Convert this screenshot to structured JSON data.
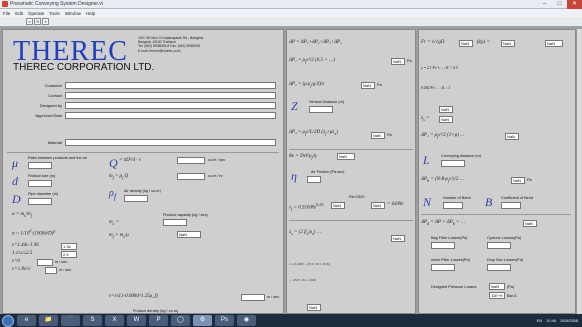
{
  "window": {
    "title": "Pneumatic Conveying System Designer.vi"
  },
  "menu": [
    "File",
    "Edit",
    "Operate",
    "Tools",
    "Window",
    "Help"
  ],
  "toolbar": [
    "⇨",
    "⟲",
    "⏸"
  ],
  "header": {
    "logo": "THEREC",
    "corp": "THEREC CORPORATION LTD.",
    "address": [
      "100 / 56 Moo 4 Kanjanapisek Rd., Bangkok,",
      "Bangkok 10150 Thailand",
      "Tel: (662) 8938005-8 Fax: (662) 8938005",
      "E-mail: therec@loxinfo.co.th"
    ]
  },
  "form": {
    "labels": [
      "Customer",
      "Contact",
      "Designed by",
      "Approved Date"
    ],
    "material": "Material"
  },
  "left": {
    "ratio_label": "Ratio between products and the air",
    "particle_size": "Partical size (m)",
    "pipe_diameter": "Pipe diameter (m)",
    "air_velocity_unit": "cu.m / sec",
    "air_volume_unit": "cu.m / hr",
    "air_density": "Air density (kg / cu.m)",
    "product_capacity": "Product capacity (kg / sec)",
    "product_density": "Product density (kg / cu.m)",
    "nan": "NaN",
    "c1": "1.36",
    "c2": "2.5",
    "ms": "m / sec",
    "eq": [
      "ε=1.44c-1.96",
      "1.1≤c≤2.5",
      "ε=0",
      "v=1.8ε√c",
      "ν=ε√(1-0.008d^1.25ρ_f)",
      "ε=1.44..."
    ]
  },
  "mid": {
    "vertical_distance": "Vertical Distance (m)",
    "air_friction": "Air Friction (Pa.sec)",
    "re2300": "Re>2300",
    "val_0316": "0.316",
    "val_64": "64",
    "re": "Re",
    "nan": "NaN",
    "pa": "Pa"
  },
  "right": {
    "conveying_distance": "Conveying distance (m)",
    "number_of_bend": "Number of Bend",
    "coeff_bend": "Coefficient of Bend",
    "bag_filter": "Bag Filter Losses(Pa)",
    "cyclone": "Cyclone Losses(Pa)",
    "inline_filter": "Inline Filter Losses(Pa)",
    "drop_box": "Drop Box Losses(Pa)",
    "designed_pressure": "Designed Pressure Losses",
    "pa_label": "(Pa)",
    "bar_val": "11E+9",
    "bar_unit": "Bar.G",
    "nan": "NaN"
  },
  "taskbar": {
    "apps": [
      "e",
      "📁",
      "🎵",
      "S",
      "X",
      "W",
      "P",
      "◯",
      "⚙",
      "Ps",
      "◉"
    ],
    "tray": [
      "EN",
      "10:46",
      "26/8/2558"
    ]
  }
}
